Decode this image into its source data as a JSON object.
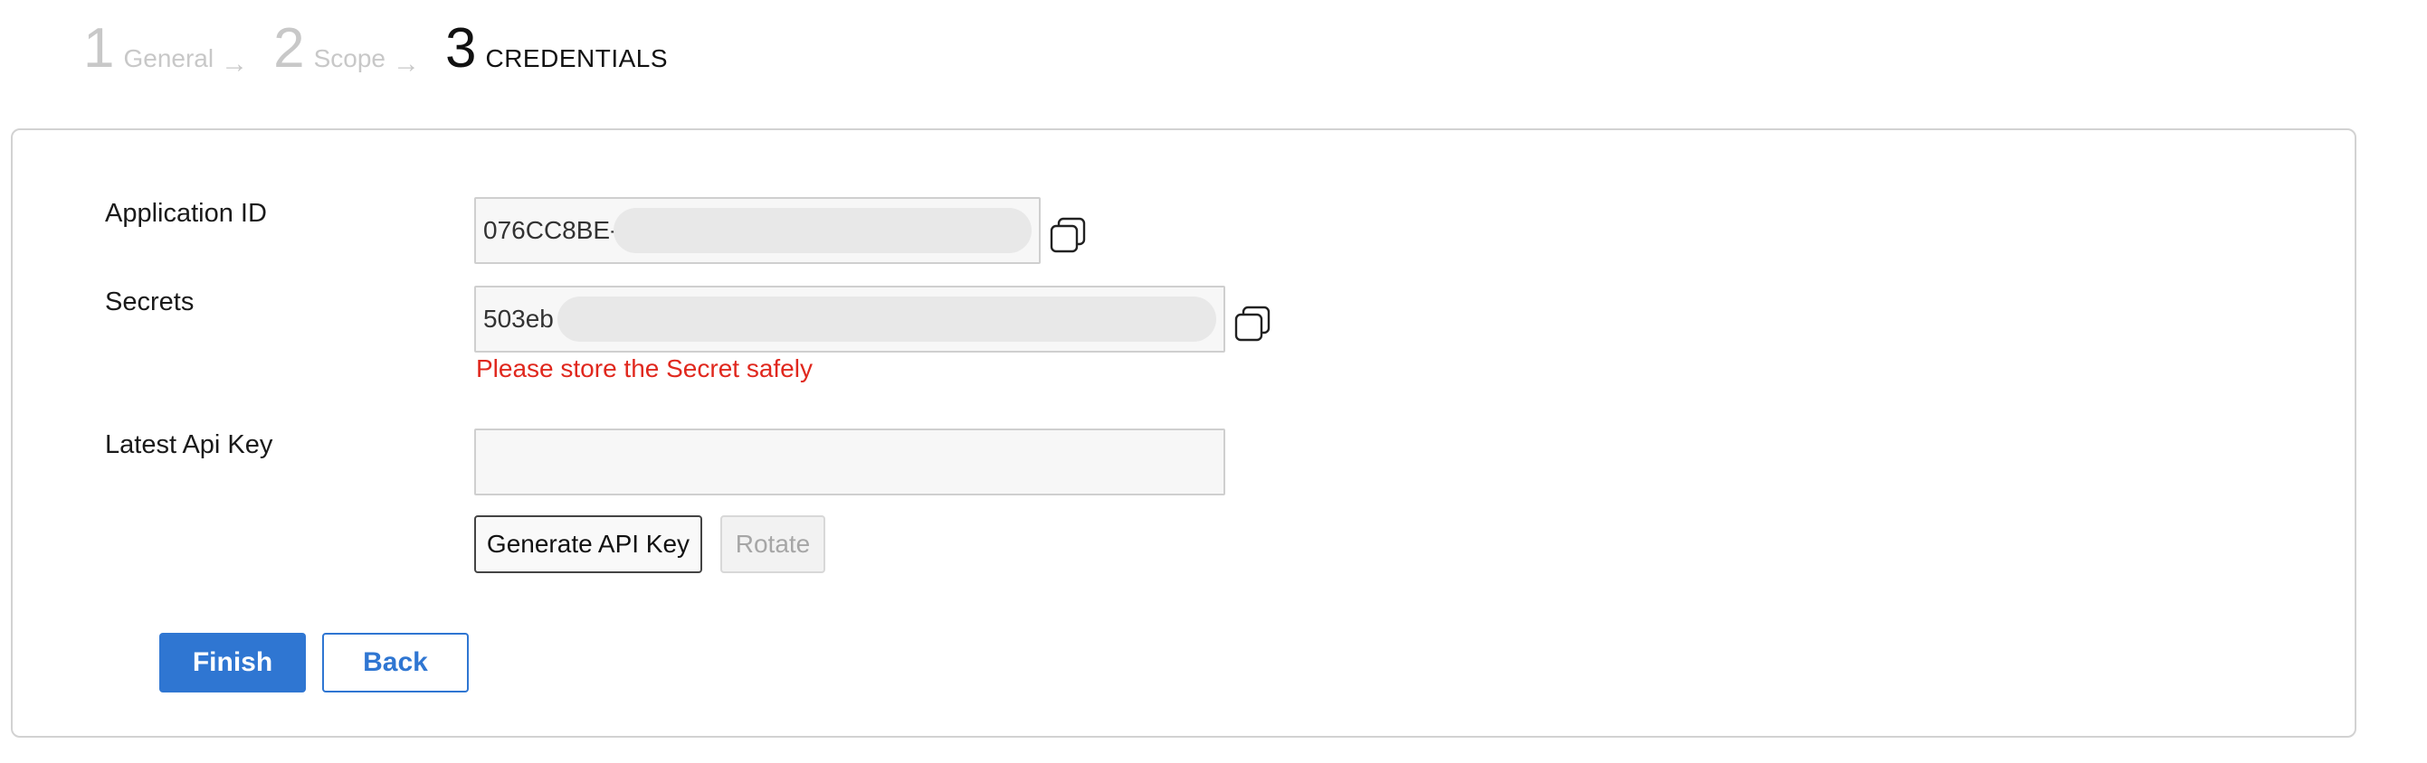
{
  "stepper": {
    "steps": [
      {
        "number": "1",
        "label": "General",
        "arrow": "→",
        "state": "done"
      },
      {
        "number": "2",
        "label": "Scope",
        "arrow": "→",
        "state": "done"
      },
      {
        "number": "3",
        "label": "CREDENTIALS",
        "state": "active"
      }
    ]
  },
  "form": {
    "application_id": {
      "label": "Application ID",
      "value": "076CC8BE-",
      "copy_icon": "copy-icon"
    },
    "secrets": {
      "label": "Secrets",
      "value": "503eb",
      "copy_icon": "copy-icon",
      "warning": "Please store the Secret safely"
    },
    "latest_api_key": {
      "label": "Latest Api Key",
      "value": ""
    },
    "buttons": {
      "generate": "Generate API Key",
      "rotate": "Rotate"
    }
  },
  "footer": {
    "finish": "Finish",
    "back": "Back"
  },
  "colors": {
    "primary": "#2f76d2",
    "warning": "#e0281e",
    "inactive_step": "#c8c8c8"
  }
}
